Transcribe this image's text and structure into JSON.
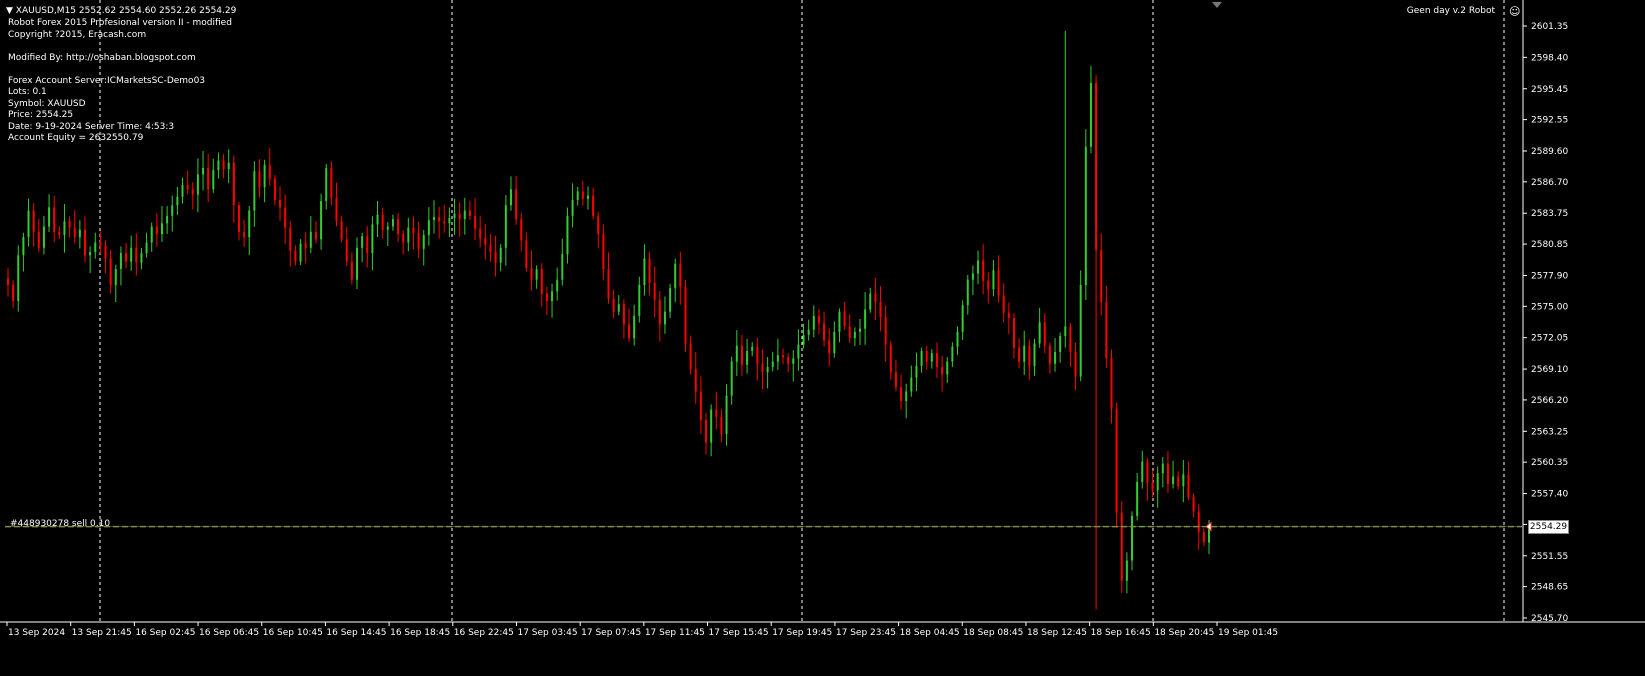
{
  "header": {
    "symbol_line": "XAUUSD,M15  2552.62 2554.60 2552.26 2554.29",
    "info_lines": [
      "Robot Forex 2015 Profesional version II - modified",
      "Copyright ?2015, Eracash.com",
      "",
      "Modified By: http://oshaban.blogspot.com",
      "",
      "Forex Account Server:ICMarketsSC-Demo03",
      "Lots:  0.1",
      "Symbol: XAUUSD",
      "Price:  2554.25",
      "Date: 9-19-2024 Server Time: 4:53:3",
      "Account Equity = 2632550.79"
    ]
  },
  "robot_name": "Geen day v.2 Robot",
  "smiley_icon": "☺",
  "order_label": "#448930278 sell 0.10",
  "current_price": "2554.29",
  "colors": {
    "bull": "#32cd32",
    "bear": "#ff0000",
    "grid": "#ffffff",
    "order_line": "#6b8e23",
    "background": "#000000"
  },
  "price_axis": {
    "ticks": [
      "2601.35",
      "2598.40",
      "2595.45",
      "2592.55",
      "2589.60",
      "2586.70",
      "2583.75",
      "2580.85",
      "2577.90",
      "2575.00",
      "2572.05",
      "2569.10",
      "2566.20",
      "2563.25",
      "2560.35",
      "2557.40",
      "2554.50",
      "2551.55",
      "2548.65",
      "2545.70"
    ]
  },
  "time_axis": {
    "ticks": [
      "13 Sep 2024",
      "13 Sep 21:45",
      "16 Sep 02:45",
      "16 Sep 06:45",
      "16 Sep 10:45",
      "16 Sep 14:45",
      "16 Sep 18:45",
      "16 Sep 22:45",
      "17 Sep 03:45",
      "17 Sep 07:45",
      "17 Sep 11:45",
      "17 Sep 15:45",
      "17 Sep 19:45",
      "17 Sep 23:45",
      "18 Sep 04:45",
      "18 Sep 08:45",
      "18 Sep 12:45",
      "18 Sep 16:45",
      "18 Sep 20:45",
      "19 Sep 01:45"
    ]
  },
  "chart_data": {
    "type": "candlestick",
    "symbol": "XAUUSD",
    "timeframe": "M15",
    "ylim": [
      2545.7,
      2601.35
    ],
    "last_close": 2554.29,
    "order_level": 2554.29,
    "closes": [
      2577.0,
      2575.5,
      2579.8,
      2581.5,
      2584.0,
      2582.0,
      2580.5,
      2582.5,
      2584.3,
      2582.0,
      2581.7,
      2583.0,
      2582.4,
      2581.5,
      2582.2,
      2579.8,
      2580.1,
      2581.0,
      2580.7,
      2579.5,
      2577.0,
      2578.5,
      2580.0,
      2579.2,
      2580.5,
      2579.1,
      2580.0,
      2581.0,
      2582.5,
      2581.8,
      2582.8,
      2583.5,
      2584.5,
      2585.3,
      2586.4,
      2586.0,
      2585.5,
      2587.4,
      2588.0,
      2586.0,
      2587.8,
      2588.7,
      2587.9,
      2588.5,
      2584.5,
      2582.0,
      2581.5,
      2584.0,
      2587.7,
      2586.2,
      2588.3,
      2587.0,
      2585.0,
      2584.3,
      2582.4,
      2580.2,
      2579.2,
      2580.9,
      2580.5,
      2582.0,
      2581.3,
      2584.9,
      2588.0,
      2585.2,
      2583.0,
      2581.3,
      2579.2,
      2577.5,
      2580.5,
      2581.6,
      2580.0,
      2582.7,
      2583.6,
      2582.2,
      2582.5,
      2583.2,
      2581.8,
      2581.0,
      2582.4,
      2581.9,
      2580.4,
      2581.7,
      2583.1,
      2583.4,
      2583.0,
      2582.8,
      2583.3,
      2583.7,
      2583.2,
      2584.0,
      2583.5,
      2582.3,
      2581.4,
      2580.8,
      2580.1,
      2579.1,
      2580.5,
      2584.5,
      2586.0,
      2583.2,
      2581.2,
      2578.6,
      2577.5,
      2578.5,
      2576.2,
      2575.5,
      2576.4,
      2577.5,
      2579.9,
      2583.5,
      2585.0,
      2585.8,
      2585.1,
      2585.4,
      2583.5,
      2581.8,
      2578.5,
      2575.7,
      2574.5,
      2575.2,
      2573.3,
      2572.0,
      2574.1,
      2577.0,
      2579.5,
      2577.2,
      2575.6,
      2573.3,
      2574.5,
      2576.7,
      2579.0,
      2576.8,
      2571.5,
      2569.1,
      2567.0,
      2564.3,
      2562.2,
      2565.3,
      2564.6,
      2563.0,
      2566.6,
      2569.8,
      2571.3,
      2569.5,
      2570.8,
      2571.2,
      2569.6,
      2568.8,
      2569.3,
      2569.8,
      2570.4,
      2570.2,
      2569.6,
      2570.1,
      2571.4,
      2572.3,
      2572.8,
      2574.1,
      2573.4,
      2571.8,
      2570.6,
      2572.6,
      2574.5,
      2573.1,
      2572.0,
      2572.6,
      2572.9,
      2574.7,
      2576.2,
      2575.4,
      2574.0,
      2571.4,
      2568.8,
      2567.4,
      2566.1,
      2567.0,
      2568.3,
      2569.4,
      2570.8,
      2569.8,
      2570.6,
      2569.3,
      2568.6,
      2569.8,
      2571.2,
      2572.6,
      2575.1,
      2577.5,
      2578.1,
      2579.3,
      2577.4,
      2576.6,
      2578.4,
      2576.0,
      2574.4,
      2573.9,
      2571.1,
      2569.8,
      2571.3,
      2569.4,
      2571.5,
      2573.5,
      2571.3,
      2569.6,
      2570.7,
      2572.2,
      2573.1,
      2570.7,
      2568.4,
      2577.0,
      2590.0,
      2596.0,
      2580.3,
      2575.4,
      2570.1,
      2565.4,
      2555.6,
      2549.2,
      2551.1,
      2555.3,
      2558.5,
      2560.4,
      2558.4,
      2557.7,
      2559.3,
      2560.2,
      2558.3,
      2559.0,
      2558.1,
      2559.2,
      2557.1,
      2555.7,
      2553.8,
      2552.8,
      2554.29
    ]
  }
}
